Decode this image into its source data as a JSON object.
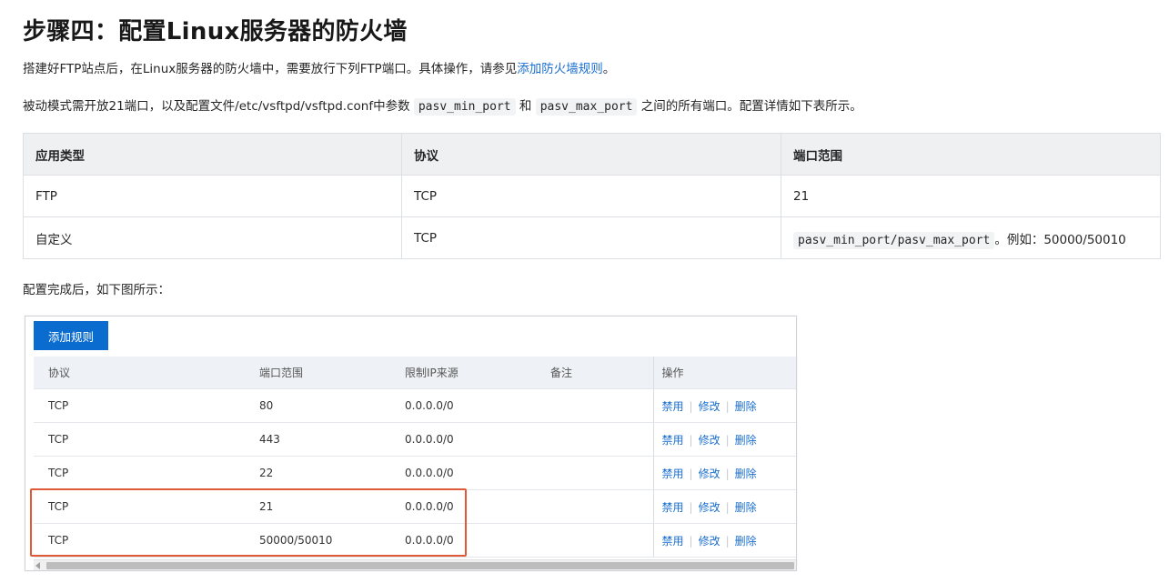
{
  "title": "步骤四：配置Linux服务器的防火墙",
  "para1": {
    "text": "搭建好FTP站点后，在Linux服务器的防火墙中，需要放行下列FTP端口。具体操作，请参见",
    "link": "添加防火墙规则",
    "end": "。"
  },
  "para2": {
    "pre": "被动模式需开放21端口，以及配置文件/etc/vsftpd/vsftpd.conf中参数 ",
    "code1": "pasv_min_port",
    "mid": " 和 ",
    "code2": "pasv_max_port",
    "post": " 之间的所有端口。配置详情如下表所示。"
  },
  "doc_table": {
    "headers": [
      "应用类型",
      "协议",
      "端口范围"
    ],
    "rows": [
      {
        "type": "FTP",
        "protocol": "TCP",
        "port": "21",
        "port_code": "",
        "port_suffix": ""
      },
      {
        "type": "自定义",
        "protocol": "TCP",
        "port": "",
        "port_code": "pasv_min_port/pasv_max_port",
        "port_suffix": "。例如：50000/50010"
      }
    ]
  },
  "para3": "配置完成后，如下图所示：",
  "console": {
    "add_button": "添加规则",
    "headers": [
      "协议",
      "端口范围",
      "限制IP来源",
      "备注",
      "操作"
    ],
    "rows": [
      {
        "protocol": "TCP",
        "port": "80",
        "source": "0.0.0.0/0",
        "note": ""
      },
      {
        "protocol": "TCP",
        "port": "443",
        "source": "0.0.0.0/0",
        "note": ""
      },
      {
        "protocol": "TCP",
        "port": "22",
        "source": "0.0.0.0/0",
        "note": ""
      },
      {
        "protocol": "TCP",
        "port": "21",
        "source": "0.0.0.0/0",
        "note": ""
      },
      {
        "protocol": "TCP",
        "port": "50000/50010",
        "source": "0.0.0.0/0",
        "note": ""
      }
    ],
    "actions": {
      "disable": "禁用",
      "edit": "修改",
      "delete": "删除",
      "separator": "|"
    }
  },
  "colors": {
    "link": "#1b6fd0",
    "button": "#0b6ccf",
    "highlight": "#e05a38"
  }
}
